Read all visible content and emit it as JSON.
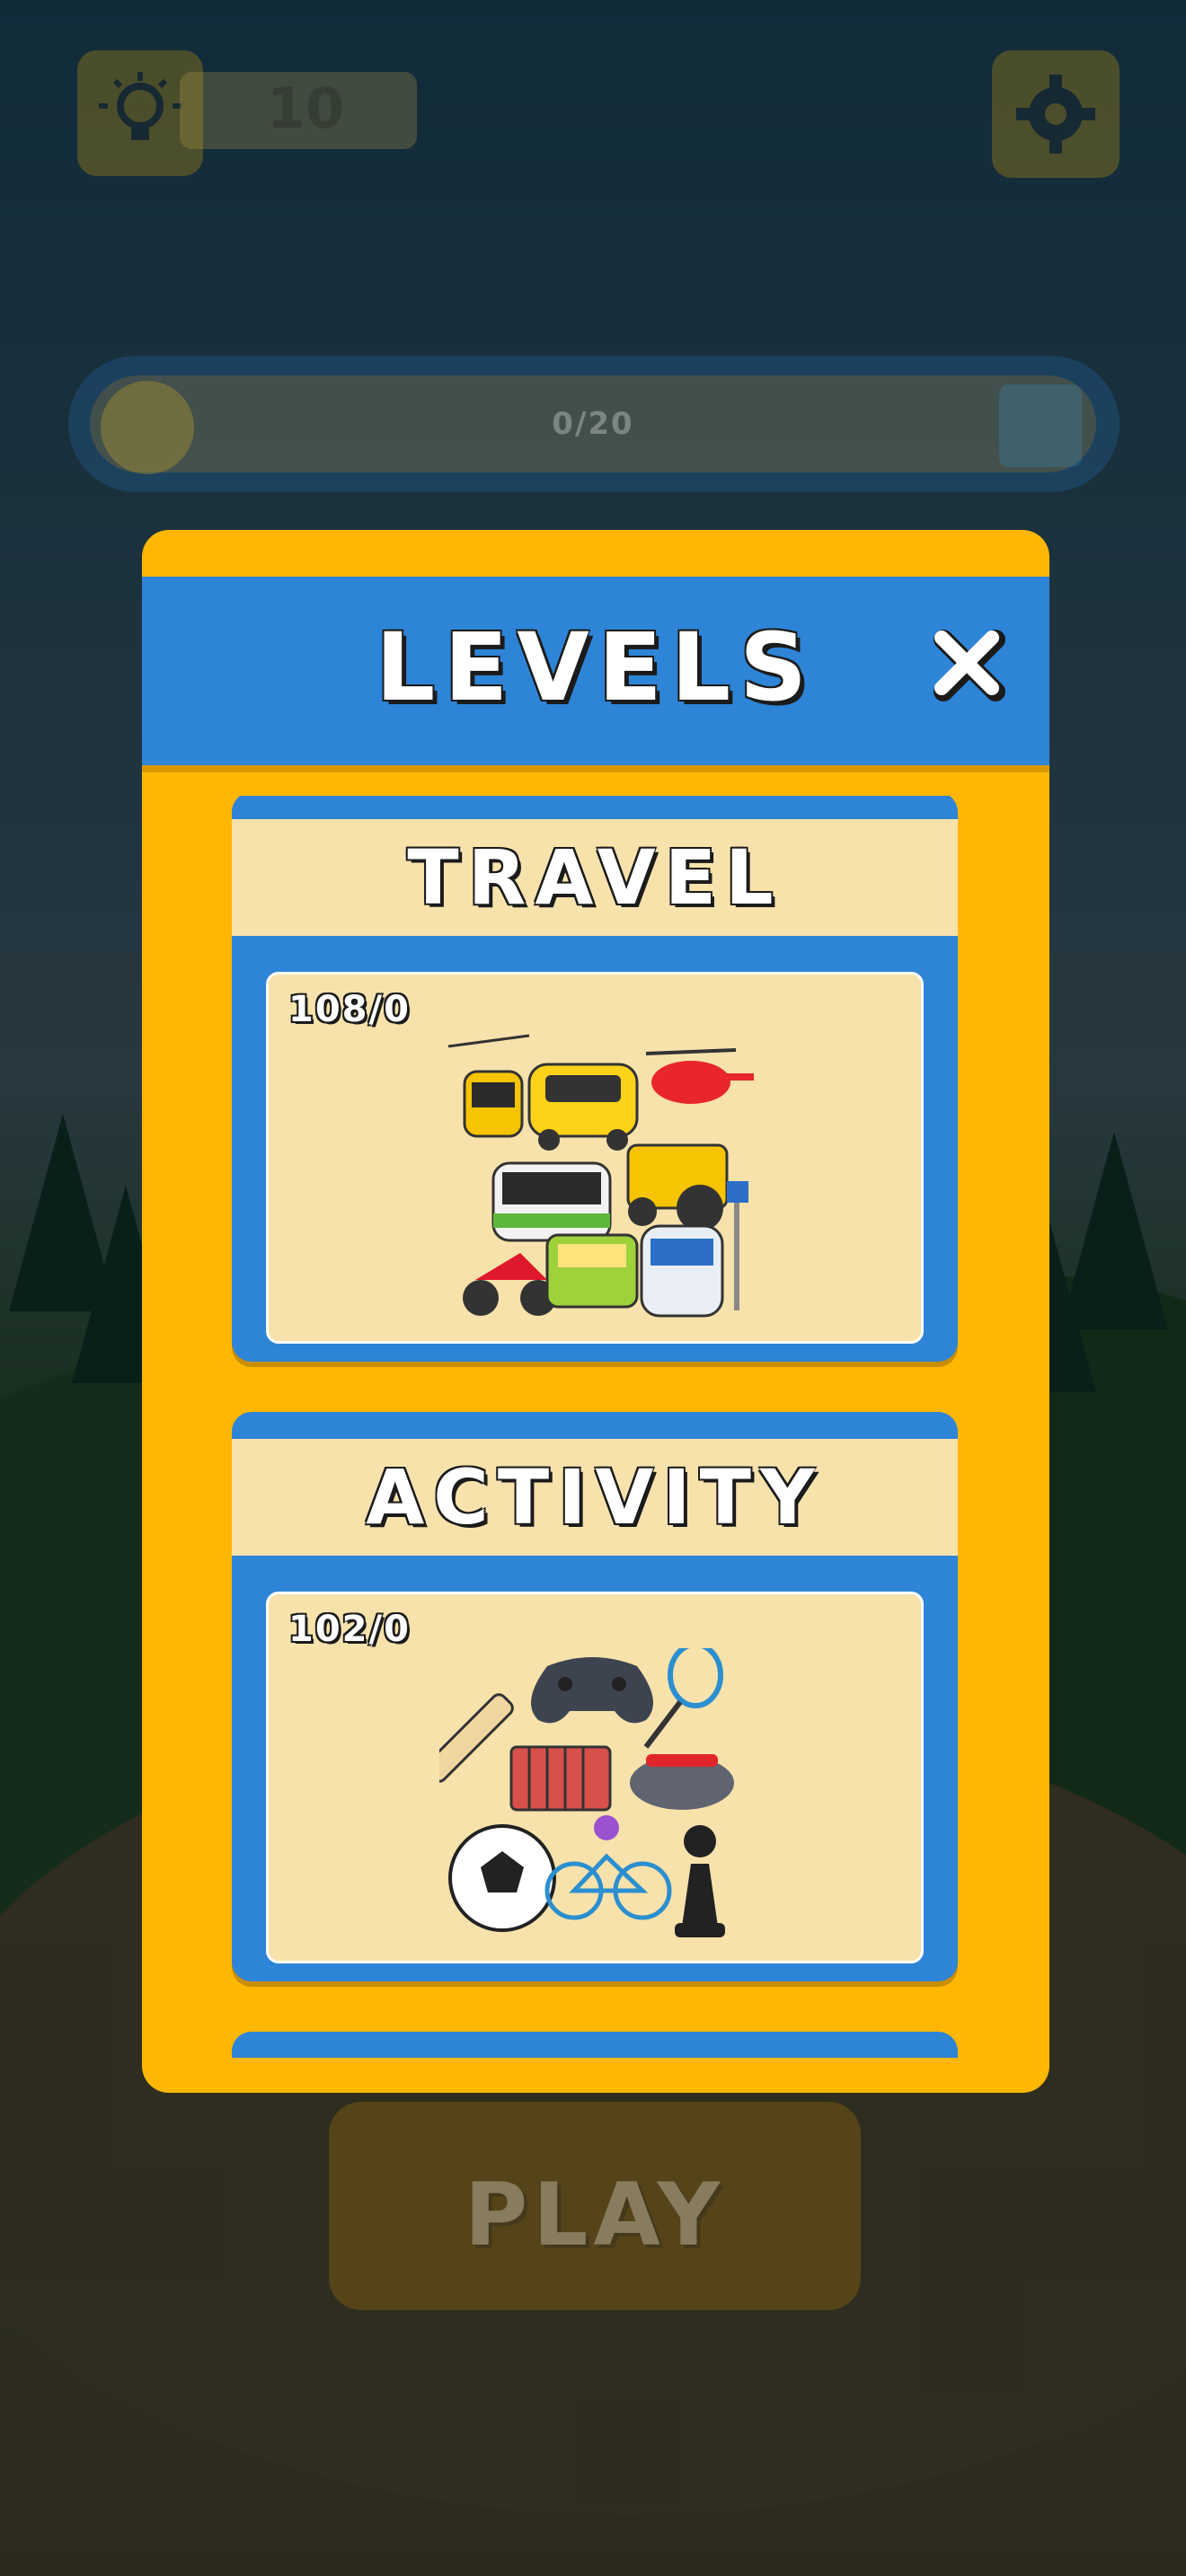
{
  "hud": {
    "hint_icon": "lightbulb-icon",
    "coins": "10",
    "settings_icon": "gear-icon",
    "progress_text": "0/20",
    "progress_fraction": 0,
    "reward_icon": "gift-icon"
  },
  "modal": {
    "title": "LEVELS",
    "close_icon": "close-icon",
    "categories": [
      {
        "name": "TRAVEL",
        "count": "108/0",
        "art": "vehicles-collage"
      },
      {
        "name": "ACTIVITY",
        "count": "102/0",
        "art": "sports-collage"
      }
    ]
  },
  "play_label": "PLAY",
  "colors": {
    "accent_yellow": "#ffb703",
    "accent_blue": "#2e84d6",
    "panel_cream": "#f8e2ac"
  }
}
